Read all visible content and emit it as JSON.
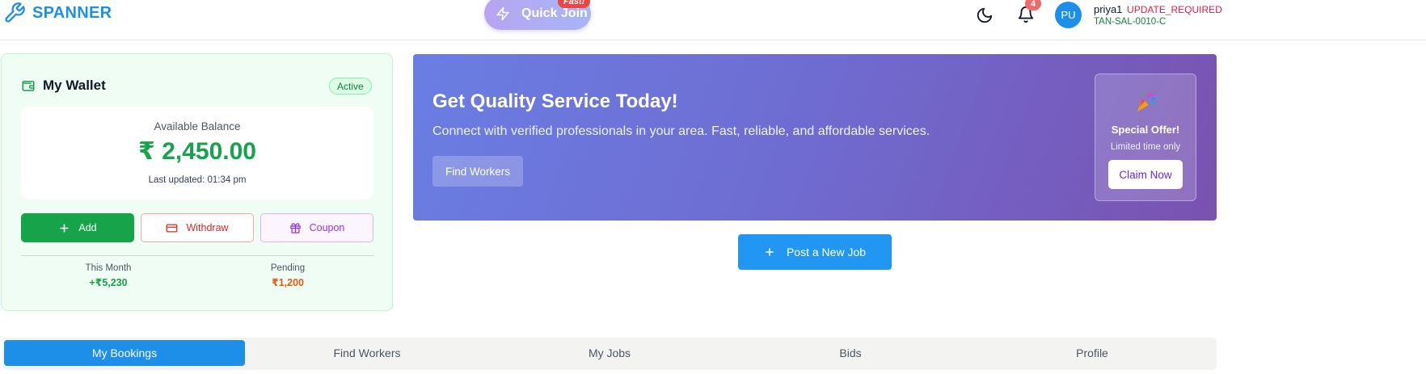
{
  "header": {
    "brand": "SPANNER",
    "quick_join": "Quick Join",
    "fast_badge": "Fast!",
    "notification_count": "4",
    "avatar_initials": "PU",
    "user_name": "priya1",
    "user_status": "UPDATE_REQUIRED",
    "user_id": "TAN-SAL-0010-C"
  },
  "wallet": {
    "title": "My Wallet",
    "status": "Active",
    "balance_label": "Available Balance",
    "balance": "₹ 2,450.00",
    "last_updated": "Last updated: 01:34 pm",
    "add_label": "Add",
    "withdraw_label": "Withdraw",
    "coupon_label": "Coupon",
    "this_month_label": "This Month",
    "this_month_value": "+₹5,230",
    "pending_label": "Pending",
    "pending_value": "₹1,200"
  },
  "hero": {
    "title": "Get Quality Service Today!",
    "subtitle": "Connect with verified professionals in your area. Fast, reliable, and affordable services.",
    "find_workers": "Find Workers",
    "offer_title": "Special Offer!",
    "offer_sub": "Limited time only",
    "claim": "Claim Now"
  },
  "post_job": "Post a New Job",
  "tabs": [
    "My Bookings",
    "Find Workers",
    "My Jobs",
    "Bids",
    "Profile"
  ],
  "active_tab": "My Bookings",
  "colors": {
    "brand": "#1d8fe8",
    "wallet_green": "#16a34a",
    "pending_orange": "#ea580c",
    "hero_gradient_start": "#6a7ee3",
    "hero_gradient_end": "#7a52b0"
  }
}
